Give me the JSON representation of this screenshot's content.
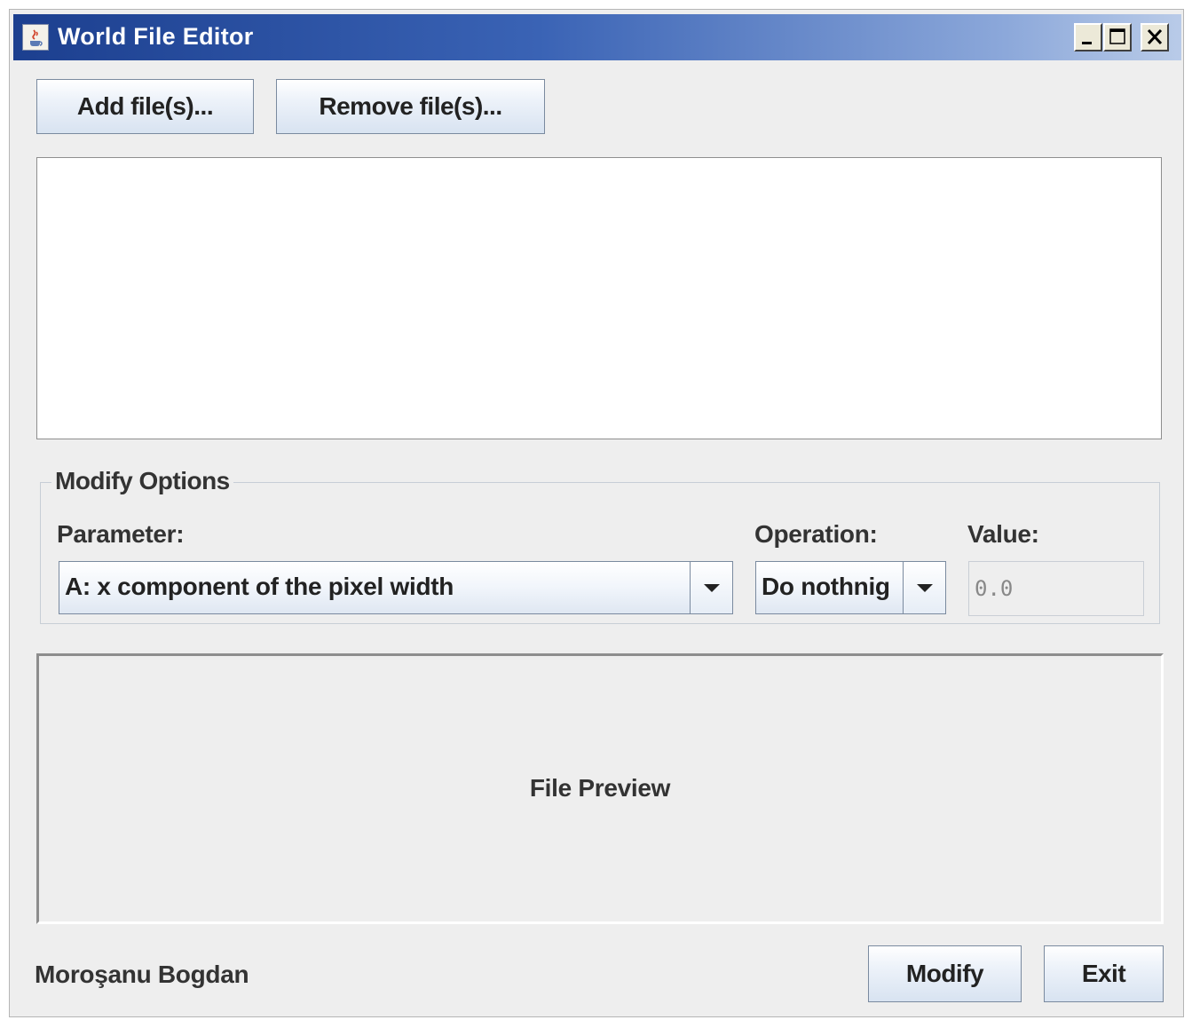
{
  "window": {
    "title": "World File Editor",
    "icons": {
      "app": "java-cup-icon",
      "minimize": "minimize-icon",
      "maximize": "maximize-icon",
      "close": "close-icon"
    }
  },
  "toolbar": {
    "add_label": "Add file(s)...",
    "remove_label": "Remove file(s)..."
  },
  "file_list": {
    "items": []
  },
  "modify_options": {
    "legend": "Modify Options",
    "parameter_label": "Parameter:",
    "parameter_value": "A: x component of the pixel width",
    "operation_label": "Operation:",
    "operation_value": "Do nothnig",
    "value_label": "Value:",
    "value_value": "0.0"
  },
  "preview": {
    "label": "File Preview"
  },
  "footer": {
    "author": "Moroşanu Bogdan",
    "modify_label": "Modify",
    "exit_label": "Exit"
  },
  "colors": {
    "window_bg": "#eeeeee",
    "titlebar_start": "#1c3f8f",
    "titlebar_end": "#b9cbe8",
    "text": "#333333"
  }
}
